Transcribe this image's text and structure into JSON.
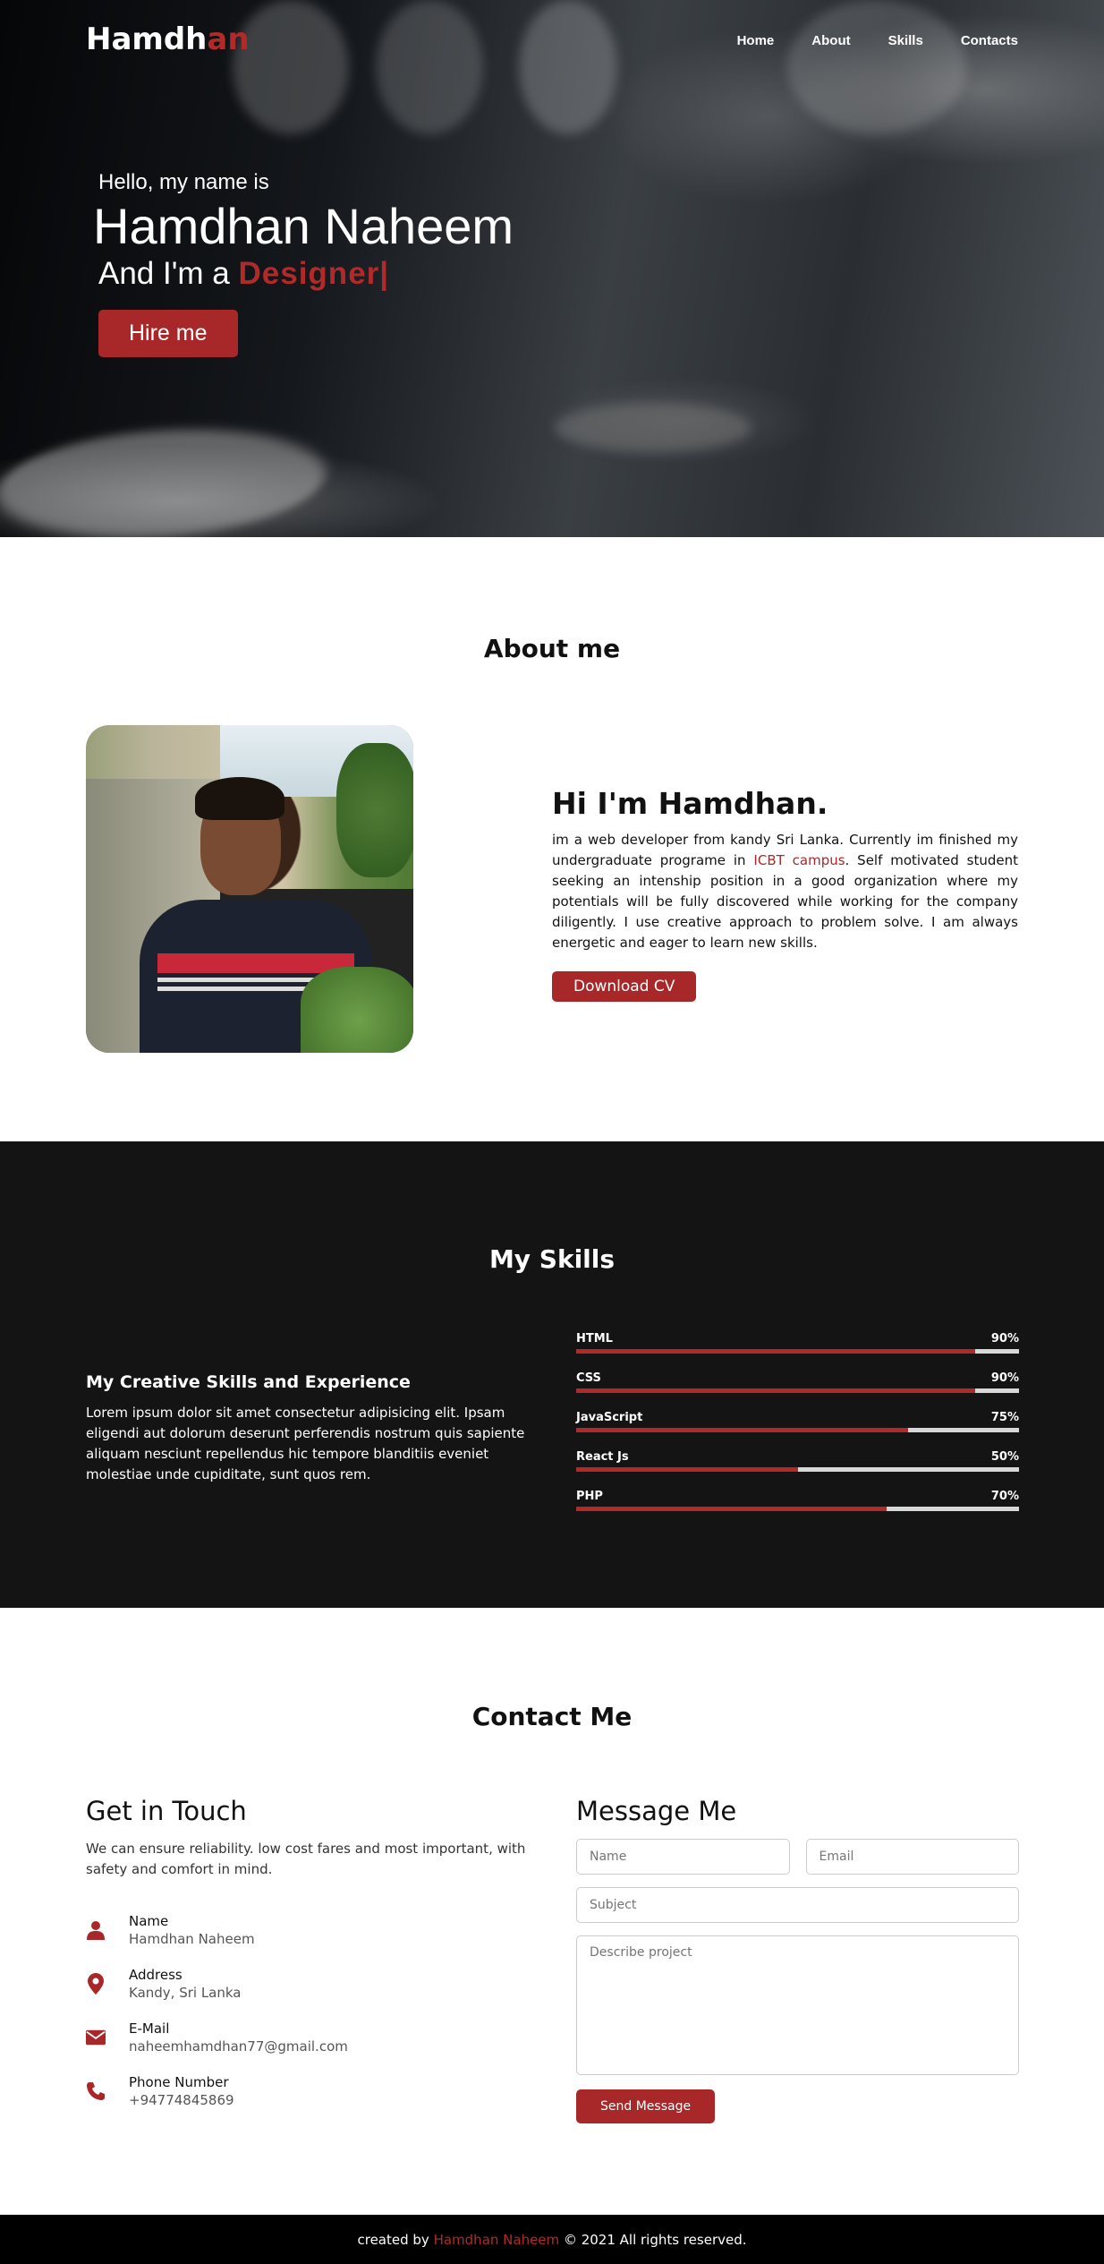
{
  "nav": {
    "logo_main": "Hamdh",
    "logo_accent": "an",
    "links": [
      "Home",
      "About",
      "Skills",
      "Contacts"
    ]
  },
  "hero": {
    "hello": "Hello, my name is",
    "name": "Hamdhan Naheem",
    "role_prefix": "And I'm a",
    "role_typed": "Designer|",
    "hire_label": "Hire me"
  },
  "about": {
    "title": "About me",
    "heading": "Hi I'm Hamdhan.",
    "text_before": "im a web developer from kandy Sri Lanka. Currently im finished my undergraduate programe in ",
    "text_highlight": "ICBT campus",
    "text_after": ". Self motivated student seeking an intenship position in a good organization where my potentials will be fully discovered while working for the company diligently. I use creative approach to problem solve. I am always energetic and eager to learn new skills.",
    "download_label": "Download CV"
  },
  "skills": {
    "title": "My Skills",
    "heading": "My Creative Skills and Experience",
    "text": "Lorem ipsum dolor sit amet consectetur adipisicing elit. Ipsam eligendi aut dolorum deserunt perferendis nostrum quis sapiente aliquam nesciunt repellendus hic tempore blanditiis eveniet molestiae unde cupiditate, sunt quos rem.",
    "bars": [
      {
        "name": "HTML",
        "percent": "90%",
        "value": 90
      },
      {
        "name": "CSS",
        "percent": "90%",
        "value": 90
      },
      {
        "name": "JavaScript",
        "percent": "75%",
        "value": 75
      },
      {
        "name": "React Js",
        "percent": "50%",
        "value": 50
      },
      {
        "name": "PHP",
        "percent": "70%",
        "value": 70
      }
    ],
    "accent": "#b02a2a"
  },
  "contact": {
    "title": "Contact Me",
    "left_heading": "Get in Touch",
    "intro": "We can ensure reliability. low cost fares and most important, with safety and comfort in mind.",
    "items": [
      {
        "label": "Name",
        "value": "Hamdhan Naheem",
        "icon": "user-icon"
      },
      {
        "label": "Address",
        "value": "Kandy, Sri Lanka",
        "icon": "map-marker-icon"
      },
      {
        "label": "E-Mail",
        "value": "naheemhamdhan77@gmail.com",
        "icon": "envelope-icon"
      },
      {
        "label": "Phone Number",
        "value": "+94774845869",
        "icon": "phone-icon"
      }
    ],
    "right_heading": "Message Me",
    "name_placeholder": "Name",
    "email_placeholder": "Email",
    "subject_placeholder": "Subject",
    "message_placeholder": "Describe project",
    "send_label": "Send Message"
  },
  "footer": {
    "prefix": "created by",
    "author": "Hamdhan Naheem",
    "suffix": "© 2021 All rights reserved."
  }
}
